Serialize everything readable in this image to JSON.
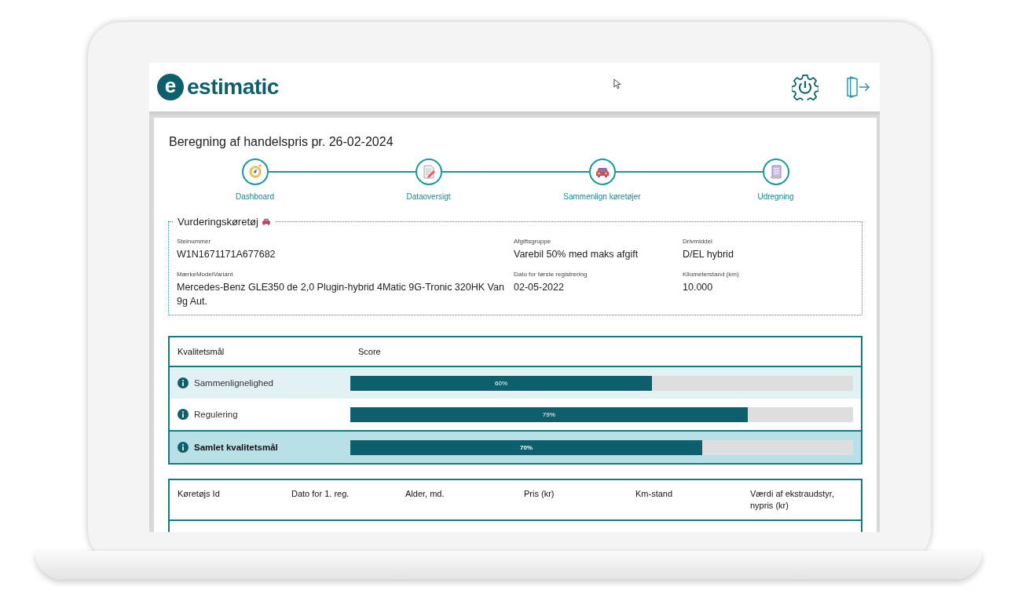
{
  "header": {
    "logo_mark": "e",
    "brand": "estimatic"
  },
  "page": {
    "title": "Beregning af handelspris pr. 26-02-2024"
  },
  "steps": [
    {
      "label": "Dashboard",
      "kind": "compass"
    },
    {
      "label": "Dataoversigt",
      "kind": "edit"
    },
    {
      "label": "Sammenlign køretøjer",
      "kind": "car"
    },
    {
      "label": "Udregning",
      "kind": "document"
    }
  ],
  "vehicle": {
    "legend": "Vurderingskøretøj",
    "fields": [
      {
        "label": "Stelnummer",
        "value": "W1N1671171A677682"
      },
      {
        "label": "Afgiftsgruppe",
        "value": "Varebil 50% med maks afgift"
      },
      {
        "label": "Drivmiddel",
        "value": "D/EL hybrid"
      },
      {
        "label": "MærkeModelVariant",
        "value": "Mercedes-Benz GLE350 de 2,0 Plugin-hybrid 4Matic 9G-Tronic 320HK Van 9g Aut."
      },
      {
        "label": "Dato for første registrering",
        "value": "02-05-2022"
      },
      {
        "label": "Kilometerstand (km)",
        "value": "10.000"
      }
    ]
  },
  "quality": {
    "columns": [
      "Kvalitetsmål",
      "Score"
    ],
    "rows": [
      {
        "name": "Sammenlignelighed",
        "level": 0.6,
        "reading": "60%",
        "kind": "measure"
      },
      {
        "name": "Regulering",
        "level": 0.79,
        "reading": "79%",
        "kind": "measure"
      },
      {
        "name": "Samlet kvalitetsmål",
        "level": 0.7,
        "reading": "70%",
        "kind": "total"
      }
    ]
  },
  "vehicles_table": {
    "columns": [
      "Køretøjs Id",
      "Dato for 1. reg.",
      "Alder, md.",
      "Pris (kr)",
      "Km-stand",
      "Værdi af ekstraudstyr, nypris (kr)"
    ]
  }
}
